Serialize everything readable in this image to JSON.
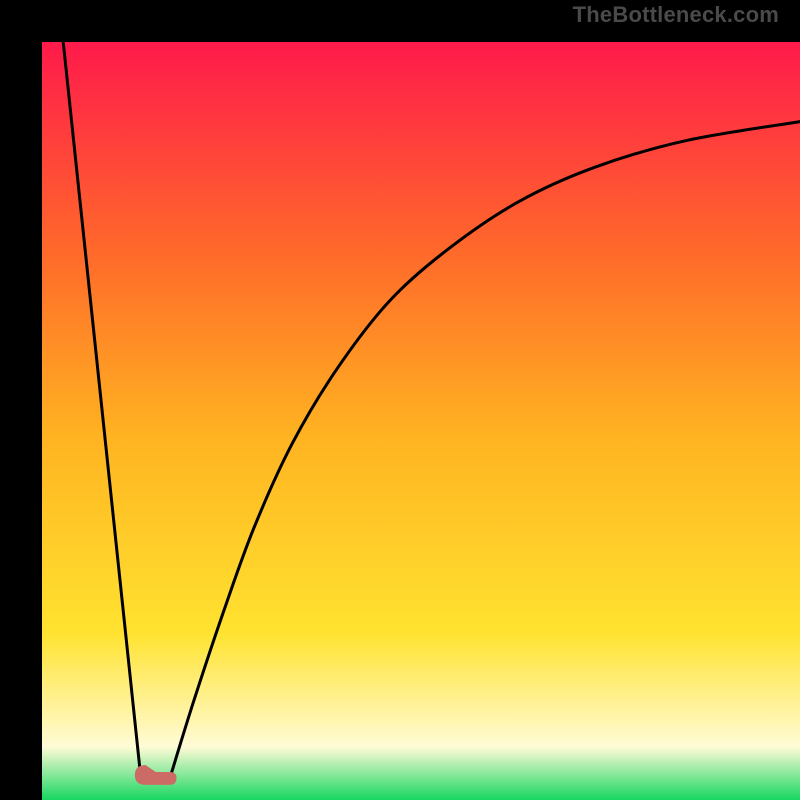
{
  "watermark": "TheBottleneck.com",
  "gradient": {
    "top": "#ff1a4b",
    "upper_mid": "#ff6a2a",
    "mid": "#ffb321",
    "lower_mid": "#ffe330",
    "pale": "#fffbd6",
    "green": "#17d661"
  },
  "chart_data": {
    "type": "line",
    "title": "",
    "xlabel": "",
    "ylabel": "",
    "xlim": [
      0,
      100
    ],
    "ylim": [
      0,
      100
    ],
    "grid": false,
    "legend": false,
    "annotations": [],
    "series": [
      {
        "name": "v-left",
        "x": [
          2.8,
          13.0
        ],
        "y": [
          100,
          3.3
        ]
      },
      {
        "name": "valley-floor",
        "x": [
          13.0,
          17.0
        ],
        "y": [
          3.3,
          3.3
        ]
      },
      {
        "name": "rise-curve",
        "x": [
          17.0,
          20.0,
          24.0,
          28.0,
          33.0,
          39.0,
          46.0,
          54.0,
          63.0,
          73.0,
          85.0,
          100.0
        ],
        "y": [
          3.3,
          13.0,
          25.0,
          36.0,
          47.0,
          57.0,
          66.0,
          73.0,
          79.0,
          83.5,
          87.0,
          89.5
        ]
      }
    ],
    "marker": {
      "shape": "rounded-blob",
      "color": "#cc6b66",
      "center_x": 15.0,
      "center_y": 3.3,
      "width": 5.5,
      "height": 2.6
    }
  }
}
